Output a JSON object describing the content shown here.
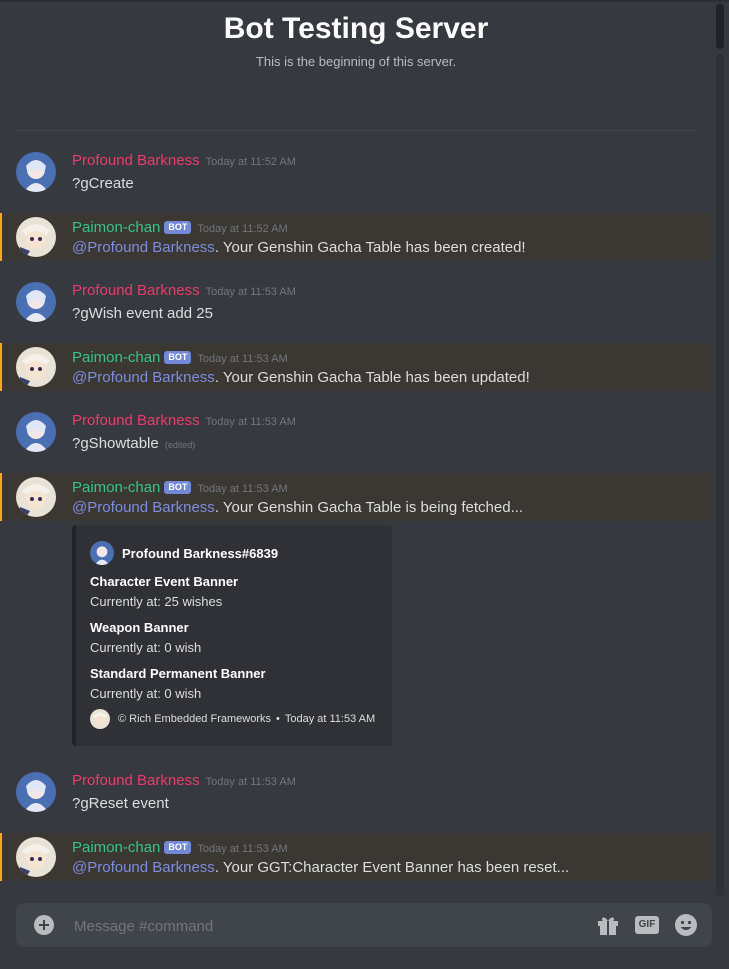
{
  "server": {
    "title": "Bot Testing Server",
    "subtitle": "This is the beginning of this server."
  },
  "messages": [
    {
      "author": "Profound Barkness",
      "time": "Today at 11:52 AM",
      "text": "?gCreate",
      "type": "user"
    },
    {
      "author": "Paimon-chan",
      "bot_tag": "BOT",
      "time": "Today at 11:52 AM",
      "mention": "@Profound Barkness",
      "text": ". Your Genshin Gacha Table has been created!",
      "type": "bot"
    },
    {
      "author": "Profound Barkness",
      "time": "Today at 11:53 AM",
      "text": "?gWish event add 25",
      "type": "user"
    },
    {
      "author": "Paimon-chan",
      "bot_tag": "BOT",
      "time": "Today at 11:53 AM",
      "mention": "@Profound Barkness",
      "text": ". Your Genshin Gacha Table has been updated!",
      "type": "bot"
    },
    {
      "author": "Profound Barkness",
      "time": "Today at 11:53 AM",
      "text": "?gShowtable",
      "edited": "(edited)",
      "type": "user"
    },
    {
      "author": "Paimon-chan",
      "bot_tag": "BOT",
      "time": "Today at 11:53 AM",
      "mention": "@Profound Barkness",
      "text": ". Your Genshin Gacha Table is being fetched...",
      "type": "bot"
    },
    {
      "author": "Profound Barkness",
      "time": "Today at 11:53 AM",
      "text": "?gReset event",
      "type": "user"
    },
    {
      "author": "Paimon-chan",
      "bot_tag": "BOT",
      "time": "Today at 11:53 AM",
      "mention": "@Profound Barkness",
      "text": ". Your GGT:Character Event Banner has been reset...",
      "type": "bot"
    }
  ],
  "embed": {
    "author": "Profound Barkness#6839",
    "fields": [
      {
        "name": "Character Event Banner",
        "value": "Currently at: 25 wishes"
      },
      {
        "name": "Weapon Banner",
        "value": "Currently at: 0 wish"
      },
      {
        "name": "Standard Permanent Banner",
        "value": "Currently at: 0 wish"
      }
    ],
    "footer_text": "© Rich Embedded Frameworks",
    "footer_sep": "•",
    "footer_time": "Today at 11:53 AM"
  },
  "composer": {
    "placeholder": "Message #command",
    "gif_label": "GIF"
  },
  "colors": {
    "background": "#36393f",
    "user_name": "#ec3b6b",
    "bot_name": "#36c38a",
    "mention": "#7d8ce0",
    "highlight_bar": "#faa61a",
    "bot_tag": "#7289da"
  },
  "icons": [
    "user-avatar-icon",
    "bot-avatar-icon",
    "add-attachment-icon",
    "gift-icon",
    "gif-icon",
    "emoji-icon"
  ]
}
